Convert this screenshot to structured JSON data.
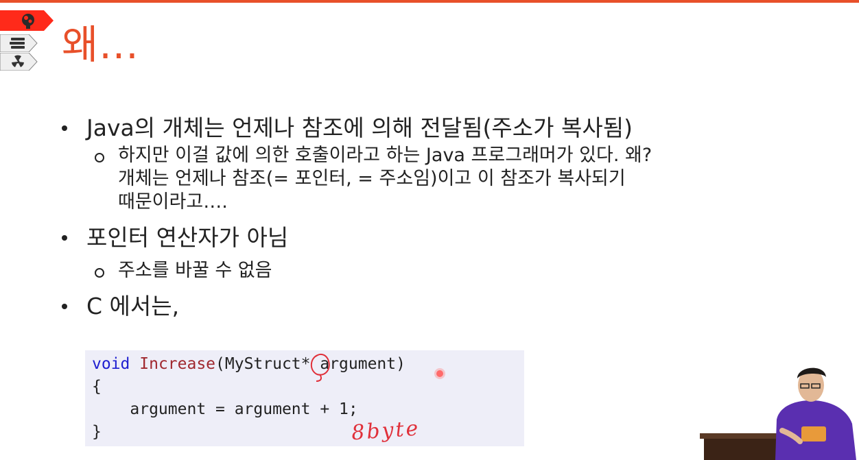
{
  "slide": {
    "title": "왜...",
    "nav_icons": [
      "brain-icon",
      "book-stack-icon",
      "radiation-icon"
    ],
    "accent_color": "#e8502a",
    "bullets": [
      {
        "text": "Java의 개체는 언제나 참조에 의해 전달됨(주소가 복사됨)",
        "subs": [
          {
            "lines": [
              "하지만 이걸 값에 의한 호출이라고 하는 Java 프로그래머가 있다. 왜?",
              "개체는 언제나 참조(= 포인터, = 주소임)이고 이 참조가 복사되기",
              "때문이라고…."
            ]
          }
        ]
      },
      {
        "text": "포인터 연산자가 아님",
        "subs": [
          {
            "lines": [
              "주소를 바꿀 수 없음"
            ]
          }
        ]
      },
      {
        "text": "C 에서는,",
        "subs": []
      }
    ],
    "code": {
      "line1_kw": "void",
      "line1_fn": "Increase",
      "line1_rest": "(MyStruct* argument)",
      "line2": "{",
      "line3": "    argument = argument + 1;",
      "line4": "}"
    },
    "handwriting": "8byte",
    "handwriting_color": "#e0303a"
  }
}
